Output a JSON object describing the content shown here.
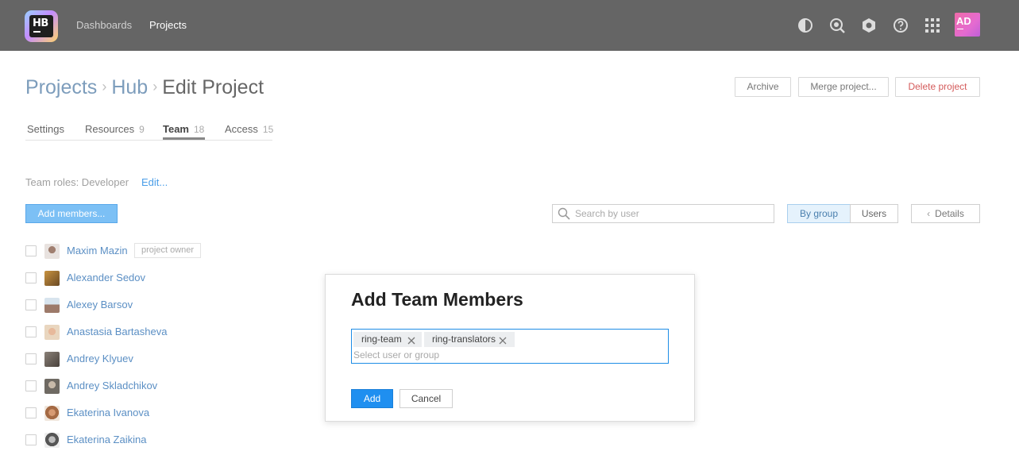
{
  "header": {
    "logo_text": "HB",
    "nav": [
      {
        "label": "Dashboards",
        "active": false
      },
      {
        "label": "Projects",
        "active": true
      }
    ],
    "icons": [
      "contrast-icon",
      "search-history-icon",
      "settings-icon",
      "help-icon",
      "apps-grid-icon"
    ],
    "avatar_initials": "AD"
  },
  "breadcrumb": {
    "items": [
      "Projects",
      "Hub"
    ],
    "separator": "›",
    "current": "Edit Project"
  },
  "actions": {
    "archive": "Archive",
    "merge": "Merge project...",
    "delete": "Delete project"
  },
  "tabs": [
    {
      "label": "Settings",
      "count": ""
    },
    {
      "label": "Resources",
      "count": "9"
    },
    {
      "label": "Team",
      "count": "18",
      "active": true
    },
    {
      "label": "Access",
      "count": "15"
    }
  ],
  "team": {
    "roles_text": "Team roles: Developer",
    "edit_label": "Edit...",
    "add_members_label": "Add members...",
    "search_placeholder": "Search by user",
    "view_by_group": "By group",
    "view_users": "Users",
    "details_label": "Details",
    "details_chevron": "‹"
  },
  "members": [
    {
      "name": "Maxim Mazin",
      "badge": "project owner"
    },
    {
      "name": "Alexander Sedov"
    },
    {
      "name": "Alexey Barsov"
    },
    {
      "name": "Anastasia Bartasheva"
    },
    {
      "name": "Andrey Klyuev"
    },
    {
      "name": "Andrey Skladchikov"
    },
    {
      "name": "Ekaterina Ivanova"
    },
    {
      "name": "Ekaterina Zaikina"
    }
  ],
  "dialog": {
    "title": "Add Team Members",
    "tags": [
      "ring-team",
      "ring-translators"
    ],
    "input_placeholder": "Select user or group",
    "add_label": "Add",
    "cancel_label": "Cancel"
  },
  "colors": {
    "header_bg": "#656565",
    "link": "#5b8fc4",
    "primary": "#1f8ff0",
    "danger": "#d45a5a"
  }
}
